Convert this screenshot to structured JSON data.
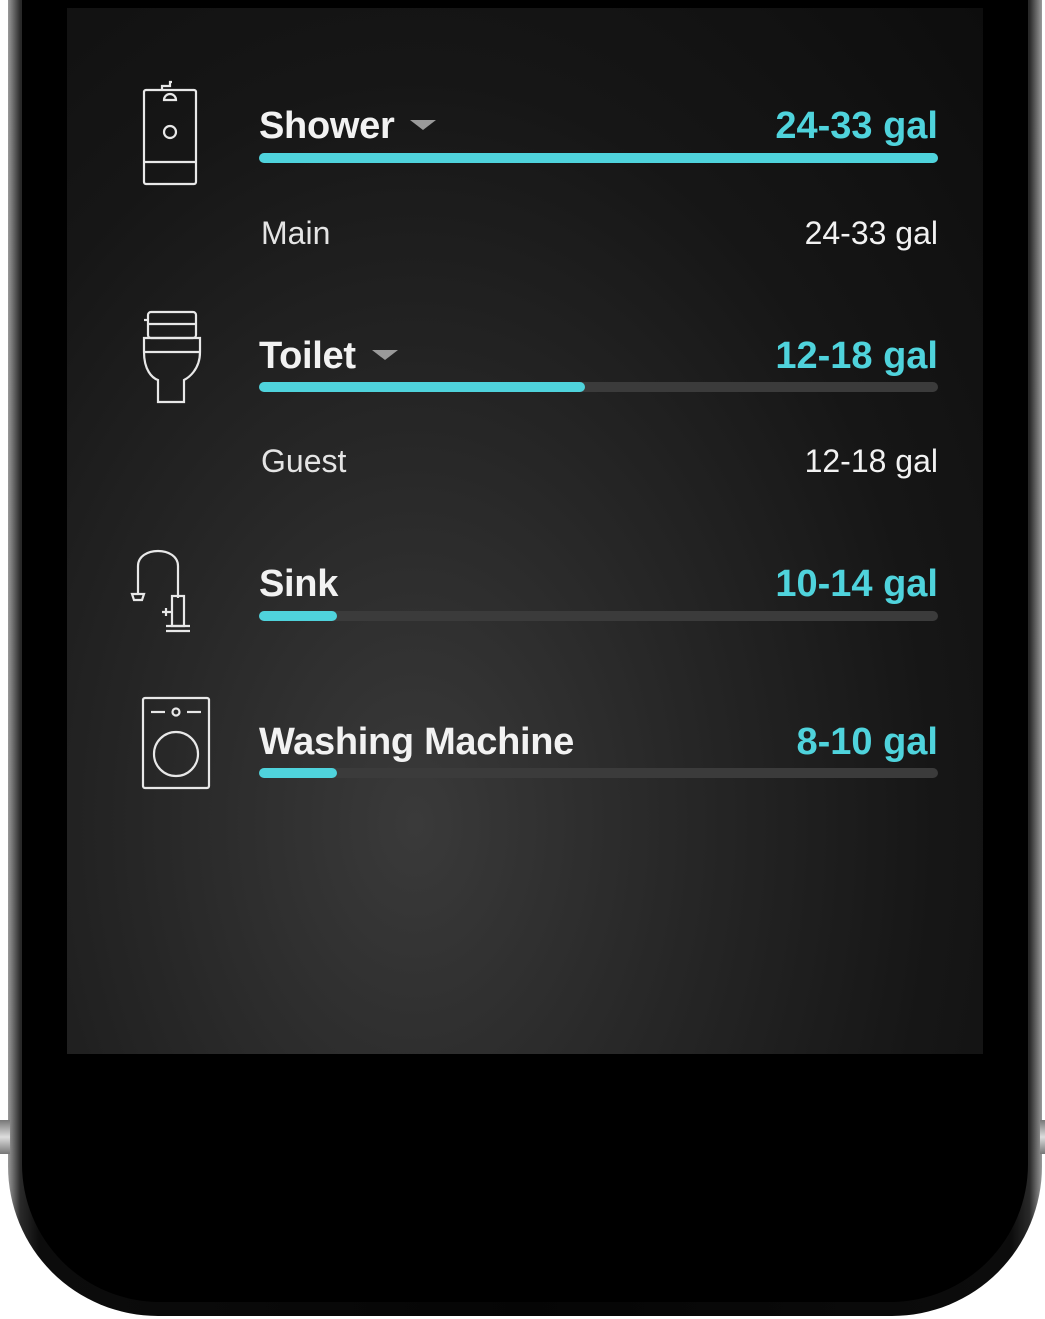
{
  "accent_color": "#4fd3dc",
  "fixtures": [
    {
      "name": "Shower",
      "icon": "shower-icon",
      "has_dropdown": true,
      "amount": "24-33 gal",
      "bar_fill_percent": 100,
      "sub": {
        "label": "Main",
        "value": "24-33 gal"
      }
    },
    {
      "name": "Toilet",
      "icon": "toilet-icon",
      "has_dropdown": true,
      "amount": "12-18 gal",
      "bar_fill_percent": 48,
      "sub": {
        "label": "Guest",
        "value": "12-18 gal"
      }
    },
    {
      "name": "Sink",
      "icon": "faucet-icon",
      "has_dropdown": false,
      "amount": "10-14 gal",
      "bar_fill_percent": 11.5
    },
    {
      "name": "Washing Machine",
      "icon": "washing-machine-icon",
      "has_dropdown": false,
      "amount": "8-10 gal",
      "bar_fill_percent": 11.5
    }
  ]
}
